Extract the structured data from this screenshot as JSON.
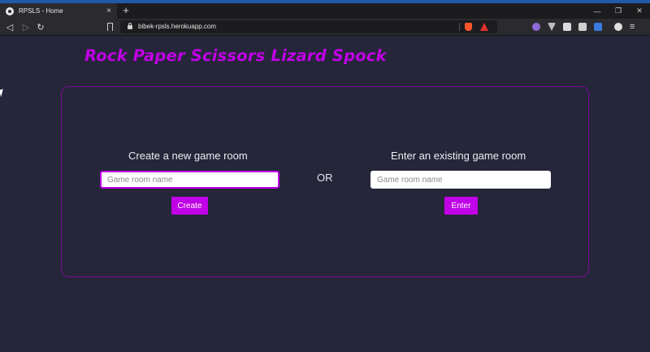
{
  "browser": {
    "tab_title": "RPSLS - Home",
    "tab_close": "×",
    "new_tab": "+",
    "url": "bibek-rpsls.herokuapp.com",
    "back": "◁",
    "forward": "▷",
    "reload": "↻",
    "window_minimize": "—",
    "window_restore": "❐",
    "window_close": "✕",
    "menu": "≡",
    "accent_color": "#1e5aa8",
    "extensions": [
      "github-icon",
      "vpn-icon",
      "notes-icon",
      "clipboard-icon",
      "translate-icon",
      "profile-icon"
    ]
  },
  "page": {
    "title": "Rock Paper Scissors Lizard Spock",
    "brand_color": "#c000e6",
    "background": "#26263a",
    "create": {
      "heading": "Create a new game room",
      "placeholder": "Game room name",
      "value": "",
      "button": "Create"
    },
    "or_label": "OR",
    "join": {
      "heading": "Enter an existing game room",
      "placeholder": "Game room name",
      "value": "",
      "button": "Enter"
    }
  }
}
